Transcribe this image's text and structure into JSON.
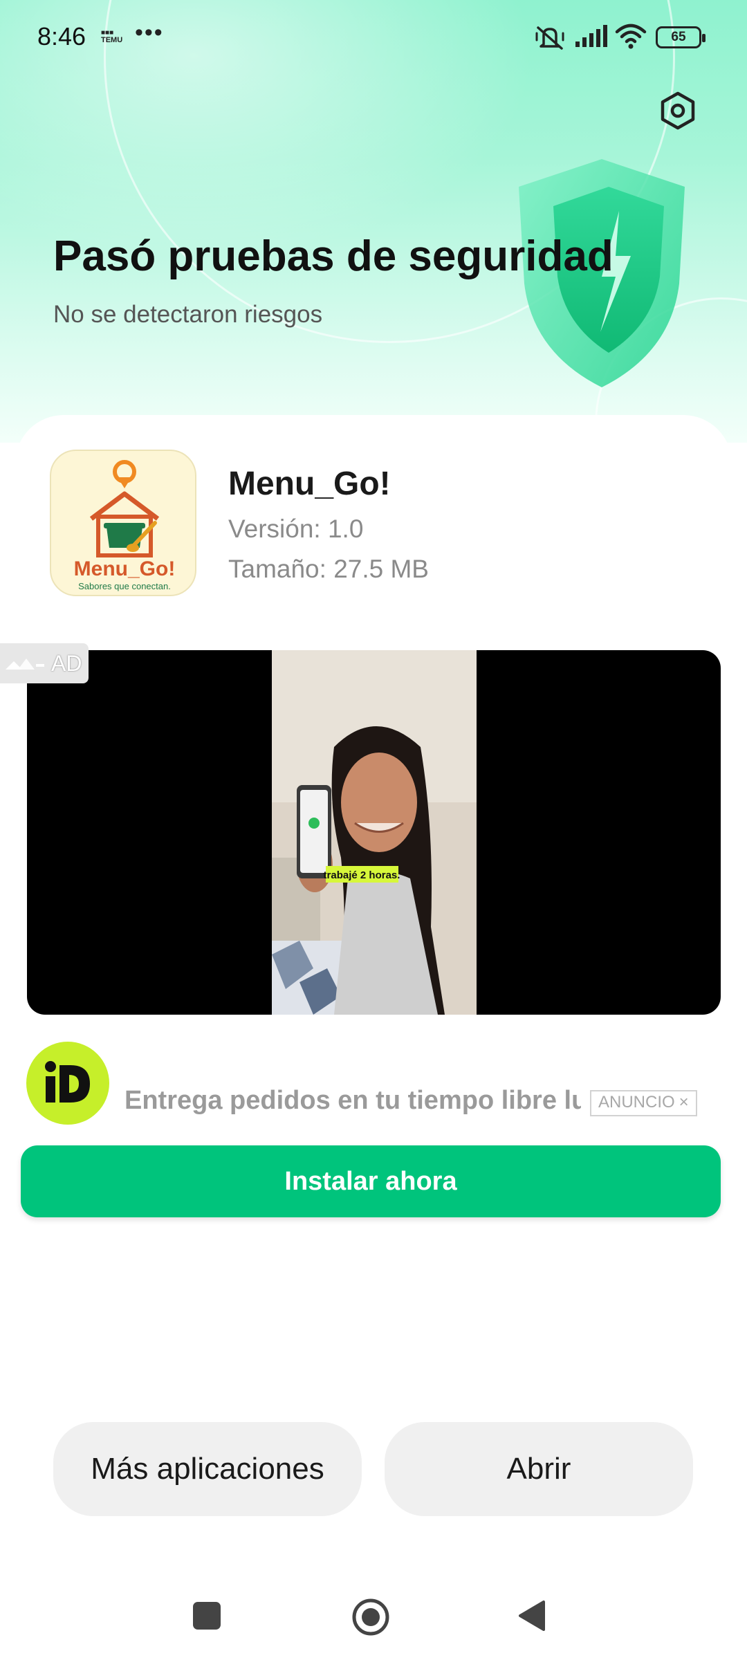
{
  "status_bar": {
    "time": "8:46",
    "temu_label": "TEMU",
    "more": "•••",
    "battery": "65"
  },
  "header": {
    "title": "Pasó pruebas de seguridad",
    "subtitle": "No se detectaron riesgos",
    "settings_icon": "settings-hexagon-icon",
    "shield_icon": "shield-check-icon"
  },
  "app": {
    "name": "Menu_Go!",
    "version": "Versión: 1.0",
    "size": "Tamaño: 27.5 MB",
    "logo_text": "Menu_Go!",
    "logo_tagline": "Sabores que conectan."
  },
  "ad": {
    "label": "AD",
    "video_caption": "trabajé 2 horas.",
    "headline": "Entrega pedidos en tu tiempo libre lu...",
    "badge": "ANUNCIO",
    "badge_close": "×",
    "cta": "Instalar ahora"
  },
  "actions": {
    "more_apps": "Más aplicaciones",
    "open": "Abrir"
  },
  "colors": {
    "accent_green": "#00c47c",
    "brand_lime": "#c6ef2a",
    "header_mint": "#8ff2cf"
  }
}
